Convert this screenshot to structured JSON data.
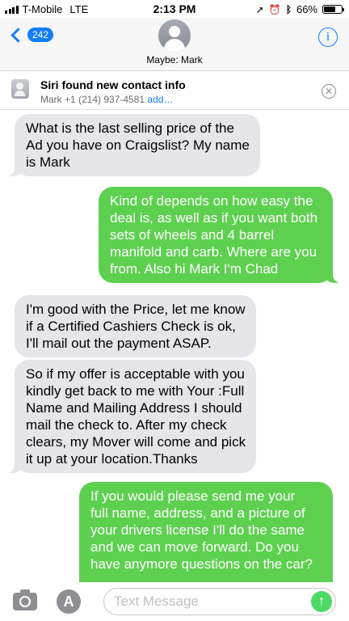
{
  "status_bar": {
    "carrier": "T-Mobile",
    "network": "LTE",
    "time": "2:13 PM",
    "battery": "66%",
    "battery_level": 0.66,
    "icons": [
      "location-arrow-icon",
      "alarm-icon",
      "bluetooth-icon"
    ]
  },
  "header": {
    "back_count": "242",
    "contact_name": "Maybe: Mark",
    "info_label": "i"
  },
  "siri": {
    "title": "Siri found new contact info",
    "detail": "Mark +1 (214) 937-4581",
    "action": "add…"
  },
  "messages": [
    {
      "direction": "in",
      "text": "What is the last selling price of the\nAd you have on Craigslist? My name\nis Mark"
    },
    {
      "direction": "out",
      "text": "Kind of depends on how easy the\ndeal is, as well as if you want both\nsets of wheels and 4 barrel\nmanifold and carb. Where are you\nfrom. Also hi Mark I'm Chad"
    },
    {
      "direction": "in",
      "text": "I'm good with the Price, let me know\nif a Certified Cashiers Check is ok,\nI'll mail out the payment ASAP."
    },
    {
      "direction": "in",
      "text": "So if my offer is acceptable with you\nkindly get back to me with Your :Full\nName and Mailing Address I should\nmail the check to. After my check\nclears, my Mover will come and pick\nit up at your location.Thanks"
    },
    {
      "direction": "out",
      "text": "If you would please send me your\nfull name, address, and a picture of\nyour drivers license I'll do the same\nand we can move forward. Do you\nhave anymore questions on the car?"
    }
  ],
  "input": {
    "placeholder": "Text Message",
    "value": ""
  },
  "colors": {
    "accent": "#147efb",
    "sms_green": "#5ed050",
    "incoming_gray": "#e5e5ea"
  }
}
